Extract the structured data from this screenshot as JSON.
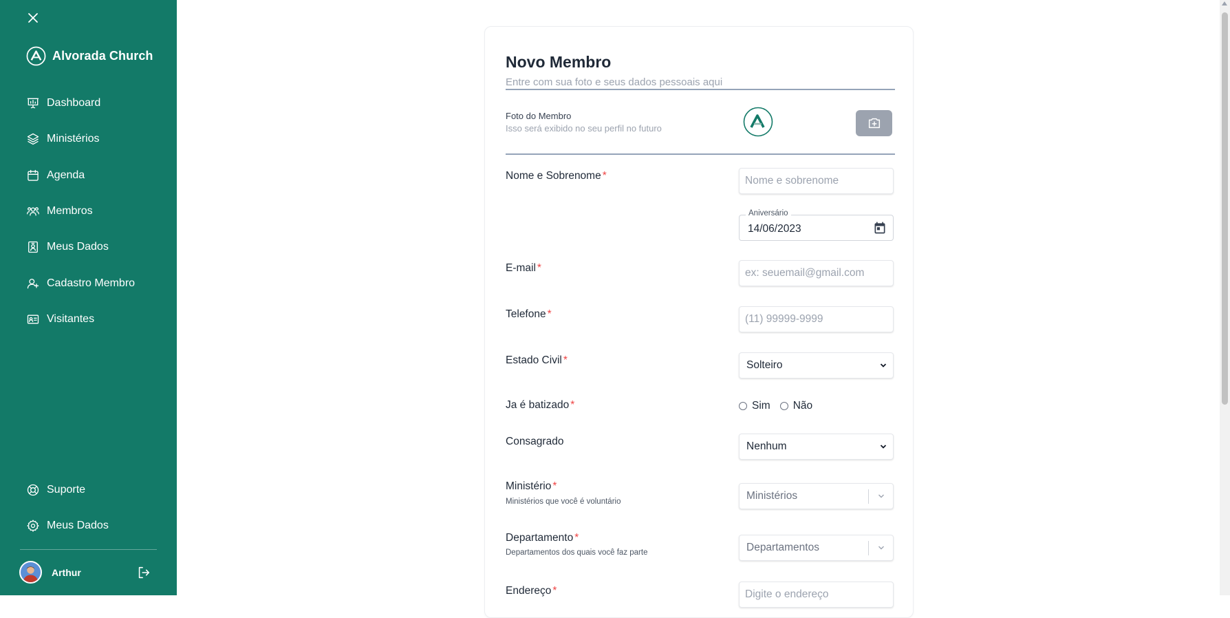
{
  "sidebar": {
    "brand": "Alvorada Church",
    "nav": [
      {
        "label": "Dashboard",
        "icon": "dashboard-icon"
      },
      {
        "label": "Ministérios",
        "icon": "layers-icon"
      },
      {
        "label": "Agenda",
        "icon": "calendar-icon"
      },
      {
        "label": "Membros",
        "icon": "users-icon"
      },
      {
        "label": "Meus Dados",
        "icon": "id-badge-icon"
      },
      {
        "label": "Cadastro Membro",
        "icon": "user-plus-icon"
      },
      {
        "label": "Visitantes",
        "icon": "id-card-icon"
      }
    ],
    "bottom": [
      {
        "label": "Suporte",
        "icon": "lifebuoy-icon"
      },
      {
        "label": "Meus Dados",
        "icon": "gear-icon"
      }
    ],
    "user": {
      "name": "Arthur"
    }
  },
  "form": {
    "title": "Novo Membro",
    "subtitle": "Entre com sua foto e seus dados pessoais aqui",
    "photo": {
      "label": "Foto do Membro",
      "hint": "Isso será exibido no seu perfil no futuro"
    },
    "name": {
      "label": "Nome e Sobrenome",
      "placeholder": "Nome e sobrenome",
      "required": "*"
    },
    "birthday": {
      "legend": "Aniversário",
      "value": "14/06/2023"
    },
    "email": {
      "label": "E-mail",
      "placeholder": "ex: seuemail@gmail.com",
      "required": "*"
    },
    "phone": {
      "label": "Telefone",
      "placeholder": "(11) 99999-9999",
      "required": "*"
    },
    "civil": {
      "label": "Estado Civil",
      "value": "Solteiro",
      "required": "*"
    },
    "baptized": {
      "label": "Ja é batizado",
      "required": "*",
      "options": [
        "Sim",
        "Não"
      ]
    },
    "consecrated": {
      "label": "Consagrado",
      "value": "Nenhum"
    },
    "ministry": {
      "label": "Ministério",
      "hint": "Ministérios que você é voluntário",
      "placeholder": "Ministérios",
      "required": "*"
    },
    "department": {
      "label": "Departamento",
      "hint": "Departamentos dos quais você faz parte",
      "placeholder": "Departamentos",
      "required": "*"
    },
    "address": {
      "label": "Endereço",
      "placeholder": "Digite o endereço",
      "required": "*"
    }
  },
  "colors": {
    "sidebar": "#137a68",
    "required": "#ef4444",
    "camera_button": "#9ca3af"
  }
}
